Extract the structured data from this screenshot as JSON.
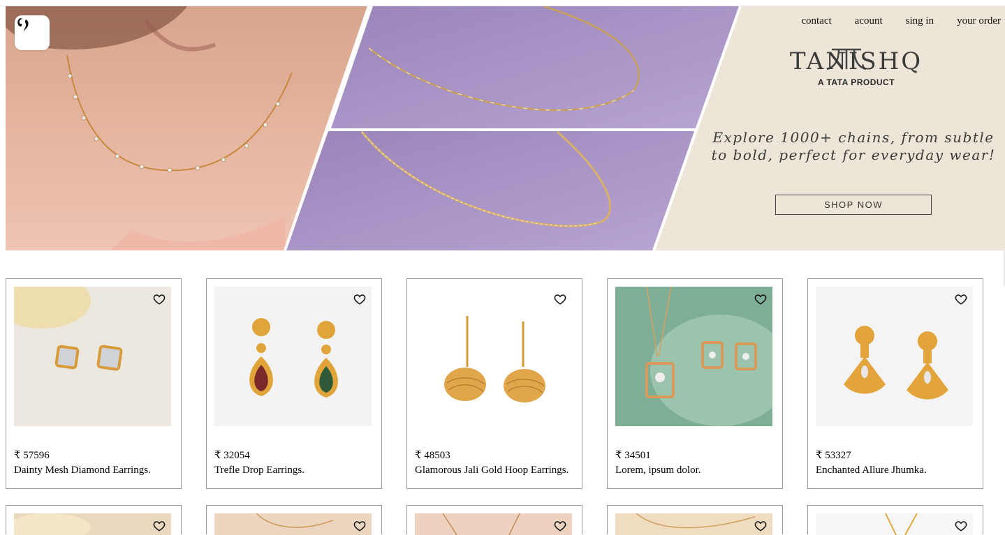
{
  "nav": {
    "items": [
      "contact",
      "acount",
      "sing in",
      "your order"
    ]
  },
  "hero": {
    "brand_name": "TANISHQ",
    "brand_sub": "A TATA PRODUCT",
    "tagline": "Explore 1000+ chains, from subtle to bold, perfect for everyday wear!",
    "cta": "SHOP NOW"
  },
  "products": [
    {
      "price": "₹ 57596",
      "name": "Dainty Mesh Diamond Earrings."
    },
    {
      "price": "₹ 32054",
      "name": "Trefle Drop Earrings."
    },
    {
      "price": "₹ 48503",
      "name": "Glamorous Jali Gold Hoop Earrings."
    },
    {
      "price": "₹ 34501",
      "name": "Lorem, ipsum dolor."
    },
    {
      "price": "₹ 53327",
      "name": "Enchanted Allure Jhumka."
    }
  ],
  "colors": {
    "accent_gold": "#d4952e",
    "hero_lavender": "#a38ec0",
    "hero_cream": "#ede6d8",
    "card_border": "#9a9a9a"
  },
  "icons": {
    "logo": "brand-logo-icon",
    "wishlist": "heart-icon"
  }
}
